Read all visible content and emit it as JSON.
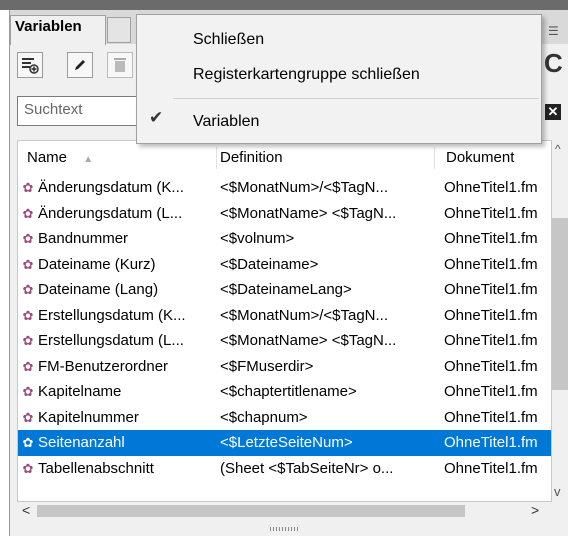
{
  "panel": {
    "tab_label": "Variablen",
    "search_placeholder": "Suchtext"
  },
  "context_menu": {
    "items": [
      {
        "label": "Schließen",
        "checked": false
      },
      {
        "label": "Registerkartengruppe schließen",
        "checked": false
      },
      {
        "label": "Variablen",
        "checked": true
      }
    ]
  },
  "table": {
    "columns": [
      "Name",
      "Definition",
      "Dokument"
    ],
    "sort_indicator": "▲",
    "rows": [
      {
        "name": "Änderungsdatum (K...",
        "definition": "<$MonatNum>/<$TagN...",
        "document": "OhneTitel1.fm"
      },
      {
        "name": "Änderungsdatum (L...",
        "definition": "<$MonatName> <$TagN...",
        "document": "OhneTitel1.fm"
      },
      {
        "name": "Bandnummer",
        "definition": "<$volnum>",
        "document": "OhneTitel1.fm"
      },
      {
        "name": "Dateiname (Kurz)",
        "definition": "<$Dateiname>",
        "document": "OhneTitel1.fm"
      },
      {
        "name": "Dateiname (Lang)",
        "definition": "<$DateinameLang>",
        "document": "OhneTitel1.fm"
      },
      {
        "name": "Erstellungsdatum (K...",
        "definition": "<$MonatNum>/<$TagN...",
        "document": "OhneTitel1.fm"
      },
      {
        "name": "Erstellungsdatum (L...",
        "definition": "<$MonatName> <$TagN...",
        "document": "OhneTitel1.fm"
      },
      {
        "name": "FM-Benutzerordner",
        "definition": "<$FMuserdir>",
        "document": "OhneTitel1.fm"
      },
      {
        "name": "Kapitelname",
        "definition": "<$chaptertitlename>",
        "document": "OhneTitel1.fm"
      },
      {
        "name": "Kapitelnummer",
        "definition": "<$chapnum>",
        "document": "OhneTitel1.fm"
      },
      {
        "name": "Seitenanzahl",
        "definition": "<$LetzteSeiteNum>",
        "document": "OhneTitel1.fm",
        "selected": true
      },
      {
        "name": "Tabellenabschnitt",
        "definition": "(Sheet <$TabSeiteNr> o...",
        "document": "OhneTitel1.fm"
      }
    ]
  },
  "colors": {
    "selection": "#0078d7",
    "variable_icon": "#9c4b7c"
  },
  "icons": [
    "new-variable-icon",
    "edit-pencil-icon",
    "delete-trash-icon",
    "refresh-icon",
    "clear-search-icon",
    "panel-menu-icon",
    "variable-gear-icon",
    "checkmark-icon",
    "scroll-left-icon",
    "scroll-right-icon",
    "scroll-up-icon",
    "scroll-down-icon"
  ]
}
